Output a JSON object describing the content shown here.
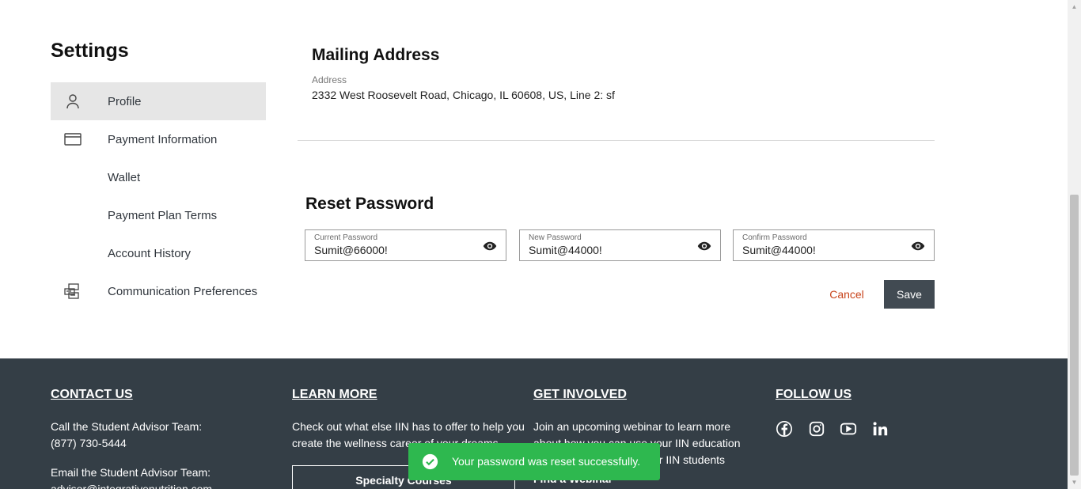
{
  "settings": {
    "title": "Settings",
    "nav": [
      {
        "label": "Profile",
        "icon": "user-icon",
        "active": true
      },
      {
        "label": "Payment Information",
        "icon": "credit-card-icon"
      },
      {
        "label": "Wallet"
      },
      {
        "label": "Payment Plan Terms"
      },
      {
        "label": "Account History"
      },
      {
        "label": "Communication Preferences",
        "icon": "mailboxes-icon"
      }
    ]
  },
  "mailing": {
    "title": "Mailing Address",
    "address_label": "Address",
    "address_value": "2332 West Roosevelt Road, Chicago, IL 60608, US, Line 2: sf"
  },
  "reset": {
    "title": "Reset Password",
    "fields": [
      {
        "label": "Current Password",
        "value": "Sumit@66000!"
      },
      {
        "label": "New Password",
        "value": "Sumit@44000!"
      },
      {
        "label": "Confirm Password",
        "value": "Sumit@44000!"
      }
    ],
    "cancel_label": "Cancel",
    "save_label": "Save",
    "cancel_color": "#c8441b",
    "save_bg": "#414a52"
  },
  "footer": {
    "bg_color": "#343e46",
    "contact": {
      "heading": "CONTACT US",
      "line1": "Call the Student Advisor Team:",
      "phone": "(877) 730-5444",
      "line2": "Email the Student Advisor Team:",
      "email": "advisor@integrativenutrition.com"
    },
    "learn": {
      "heading": "LEARN MORE",
      "line1": "Check out what else IIN has to offer to help you",
      "line2": "create the wellness career of your dreams.",
      "button": "Specialty Courses"
    },
    "involved": {
      "heading": "GET INVOLVED",
      "line1": "Join an upcoming webinar to learn more",
      "line2": "about how you can use your IIN education",
      "line3": "and other opportunities for IIN students",
      "link": "Find a Webinar"
    },
    "follow": {
      "heading": "FOLLOW US",
      "icons": [
        "facebook-icon",
        "instagram-icon",
        "youtube-icon",
        "linkedin-icon"
      ]
    }
  },
  "toast": {
    "message": "Your password was reset successfully.",
    "color": "#2eb84f"
  }
}
